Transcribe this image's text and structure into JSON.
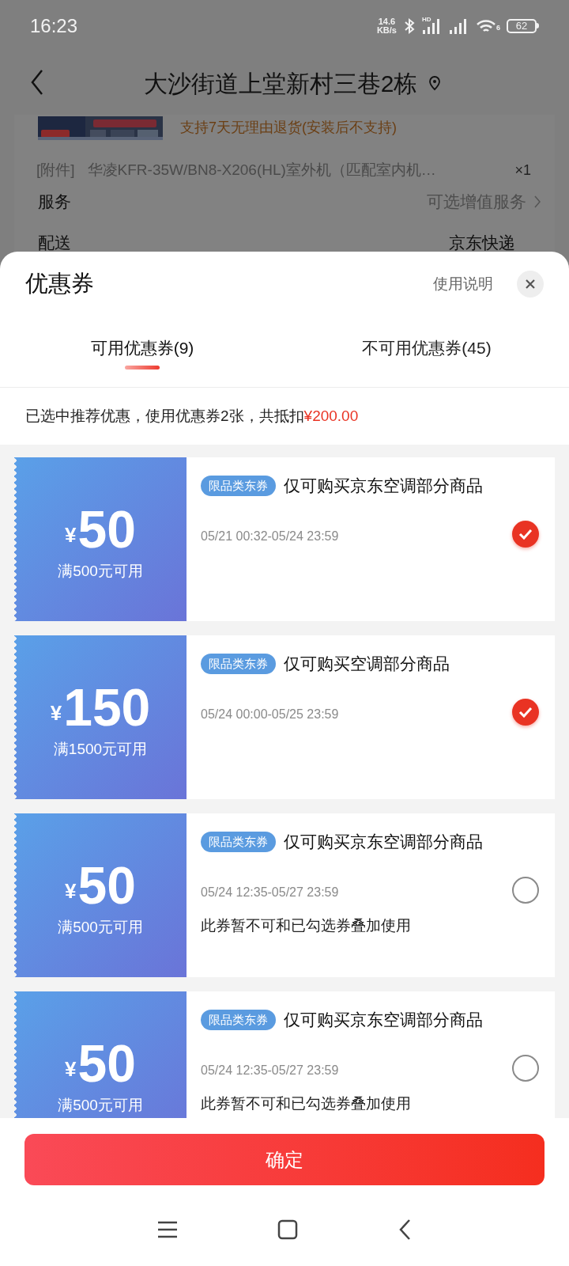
{
  "status_bar": {
    "time": "16:23",
    "net_speed_value": "14.6",
    "net_speed_unit": "KB/s",
    "signal_label": "HD",
    "wifi_label": "6",
    "battery": "62"
  },
  "header": {
    "title": "大沙街道上堂新村三巷2栋"
  },
  "order": {
    "banner_note": "支持7天无理由退货(安装后不支持)",
    "attachment": {
      "tag": "[附件]",
      "name": "华凌KFR-35W/BN8-X206(HL)室外机（匹配室内机…",
      "qty": "×1"
    },
    "rows": [
      {
        "label": "服务",
        "value": "可选增值服务",
        "kind": "link"
      },
      {
        "label": "配送",
        "value": "京东快递",
        "kind": "plain"
      }
    ]
  },
  "sheet": {
    "title": "优惠券",
    "help": "使用说明",
    "tabs": [
      {
        "label": "可用优惠券(9)",
        "selected": true
      },
      {
        "label": "不可用优惠券(45)",
        "selected": false
      }
    ],
    "summary": {
      "text": "已选中推荐优惠，使用优惠券2张，共抵扣",
      "amount": "¥200.00"
    },
    "coupons": [
      {
        "currency": "¥",
        "amount": "50",
        "condition": "满500元可用",
        "tag": "限品类东券",
        "title": "仅可购买京东空调部分商品",
        "validity": "05/21 00:32-05/24 23:59",
        "selected": true
      },
      {
        "currency": "¥",
        "amount": "150",
        "condition": "满1500元可用",
        "tag": "限品类东券",
        "title": "仅可购买空调部分商品",
        "validity": "05/24 00:00-05/25 23:59",
        "selected": true
      },
      {
        "currency": "¥",
        "amount": "50",
        "condition": "满500元可用",
        "tag": "限品类东券",
        "title": "仅可购买京东空调部分商品",
        "validity": "05/24 12:35-05/27 23:59",
        "note": "此券暂不可和已勾选券叠加使用",
        "selected": false
      },
      {
        "currency": "¥",
        "amount": "50",
        "condition": "满500元可用",
        "tag": "限品类东券",
        "title": "仅可购买京东空调部分商品",
        "validity": "05/24 12:35-05/27 23:59",
        "note": "此券暂不可和已勾选券叠加使用",
        "selected": false
      }
    ],
    "confirm": "确定"
  }
}
